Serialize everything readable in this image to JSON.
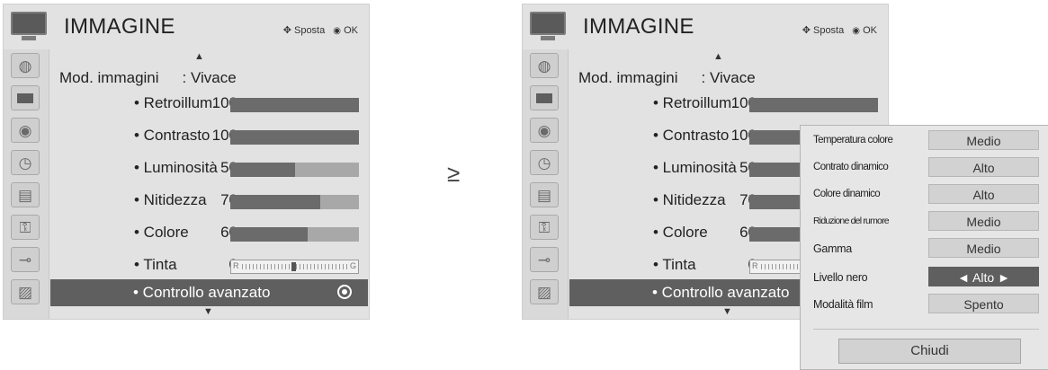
{
  "title": "IMMAGINE",
  "nav_hint": {
    "move_icon": "✥",
    "move_label": "Sposta",
    "ok_icon": "◉",
    "ok_label": "OK"
  },
  "mode": {
    "label": "Mod. immagini",
    "value": ": Vivace"
  },
  "settings": [
    {
      "label": "• Retroillum.",
      "value": "100",
      "level": 1.0
    },
    {
      "label": "• Contrasto",
      "value": "100",
      "level": 1.0
    },
    {
      "label": "• Luminosità",
      "value": "50",
      "level": 0.5
    },
    {
      "label": "• Nitidezza",
      "value": "70",
      "level": 0.7
    },
    {
      "label": "• Colore",
      "value": "60",
      "level": 0.6
    },
    {
      "label": "• Tinta",
      "value": "0",
      "tint_left": "R",
      "tint_right": "G"
    }
  ],
  "advanced": {
    "label": "• Controllo avanzato"
  },
  "connector": "≥",
  "popup": {
    "rows": [
      {
        "label": "Temperatura colore",
        "value": "Medio"
      },
      {
        "label": "Contrato dinamico",
        "value": "Alto"
      },
      {
        "label": "Colore dinamico",
        "value": "Alto"
      },
      {
        "label": "Riduzione del rumore",
        "value": "Medio"
      },
      {
        "label": "Gamma",
        "value": "Medio"
      },
      {
        "label": "Livello nero",
        "value": "◄  Alto  ►"
      },
      {
        "label": "Modalità film",
        "value": "Spento"
      }
    ],
    "close_label": "Chiudi"
  },
  "sidebar_icons": [
    "satellite-dish-icon",
    "picture-tv-icon",
    "speaker-icon",
    "clock-icon",
    "option-icon",
    "lock-icon",
    "input-plug-icon",
    "usb-photo-icon"
  ]
}
